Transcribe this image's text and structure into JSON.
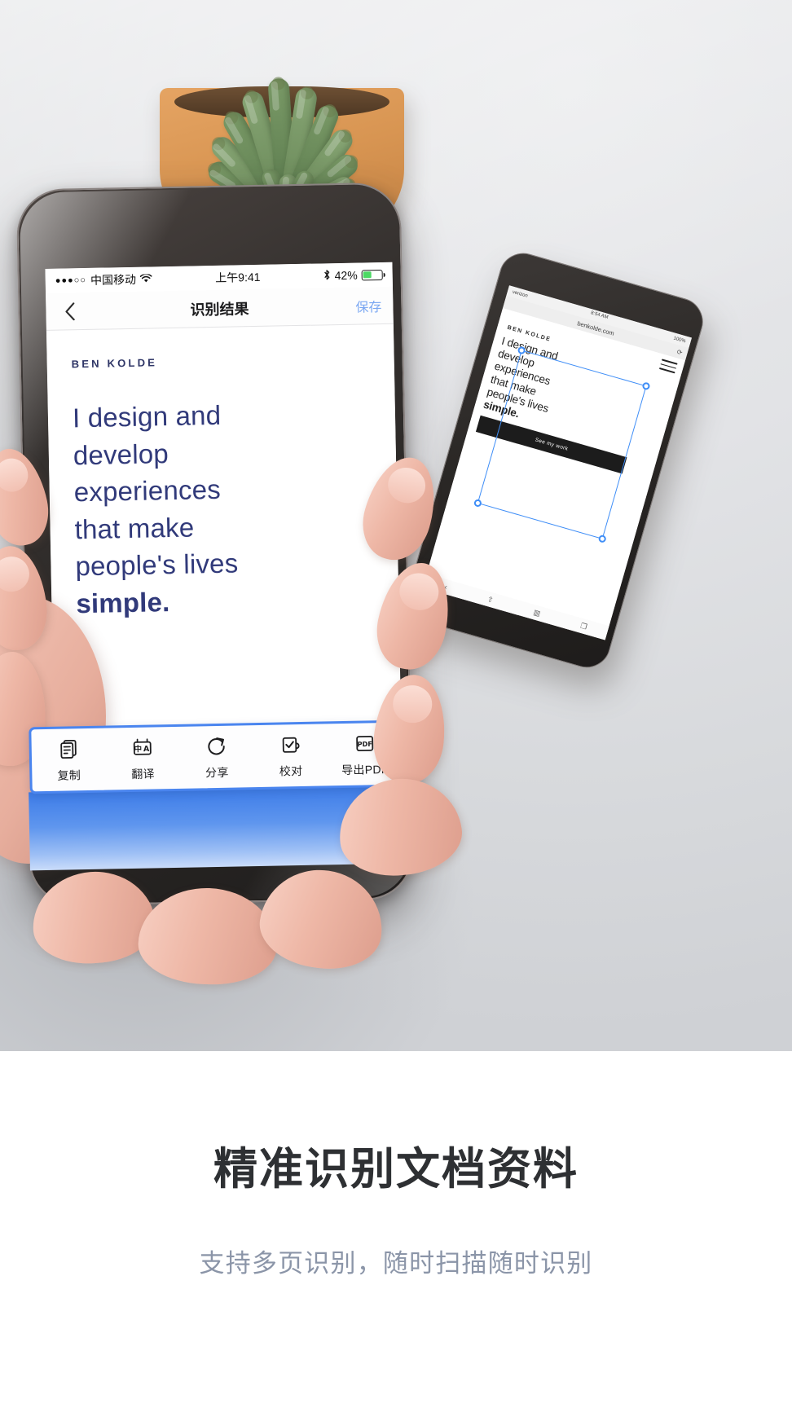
{
  "scene": {
    "description_objects": [
      "succulent-plant",
      "terracotta-pot",
      "hand",
      "iphone-foreground",
      "iphone-background"
    ]
  },
  "phone_main": {
    "status_bar": {
      "signal_dots": "●●●○○",
      "carrier": "中国移动",
      "wifi_icon": "wifi-icon",
      "time": "上午9:41",
      "bluetooth_icon": "bluetooth-icon",
      "battery_percent": "42%",
      "battery_icon": "battery-icon"
    },
    "nav_bar": {
      "back_icon": "chevron-left-icon",
      "title": "识别结果",
      "action_label": "保存"
    },
    "document": {
      "brand": "BEN KOLDE",
      "lines": [
        "I design and",
        "develop",
        "experiences",
        "that make",
        "people's lives"
      ],
      "bold_line": "simple."
    },
    "toolbar": {
      "items": [
        {
          "label": "复制",
          "icon": "copy-documents-icon"
        },
        {
          "label": "翻译",
          "icon": "translate-cn-a-icon"
        },
        {
          "label": "分享",
          "icon": "share-rotate-arrow-icon"
        },
        {
          "label": "校对",
          "icon": "proofread-check-icon"
        },
        {
          "label": "导出PDF",
          "icon": "pdf-file-icon"
        }
      ]
    }
  },
  "phone_background": {
    "status_bar": {
      "carrier": "verizon",
      "time": "8:54 AM",
      "battery_percent": "100%"
    },
    "browser": {
      "url": "benkolde.com",
      "reload_icon": "reload-icon",
      "menu_icon": "hamburger-menu-icon"
    },
    "page": {
      "brand": "BEN KOLDE",
      "lines": [
        "I design and",
        "develop",
        "experiences",
        "that make",
        "people's lives"
      ],
      "bold_line": "simple.",
      "cta_label": "See my work"
    },
    "safari_toolbar_icons": [
      "back-icon",
      "share-icon",
      "bookmarks-icon",
      "tabs-icon"
    ],
    "selection_overlay": {
      "handles": 4,
      "color": "#3f8ef7"
    }
  },
  "caption": {
    "headline": "精准识别文档资料",
    "subhead": "支持多页识别，随时扫描随时识别"
  },
  "colors": {
    "accent_blue": "#4a85ef",
    "nav_action_blue": "#7aa7f2",
    "quote_navy": "#313a7a",
    "headline_gray": "#2e3033",
    "subhead_gray": "#8b95a8",
    "battery_green": "#4cd964"
  }
}
